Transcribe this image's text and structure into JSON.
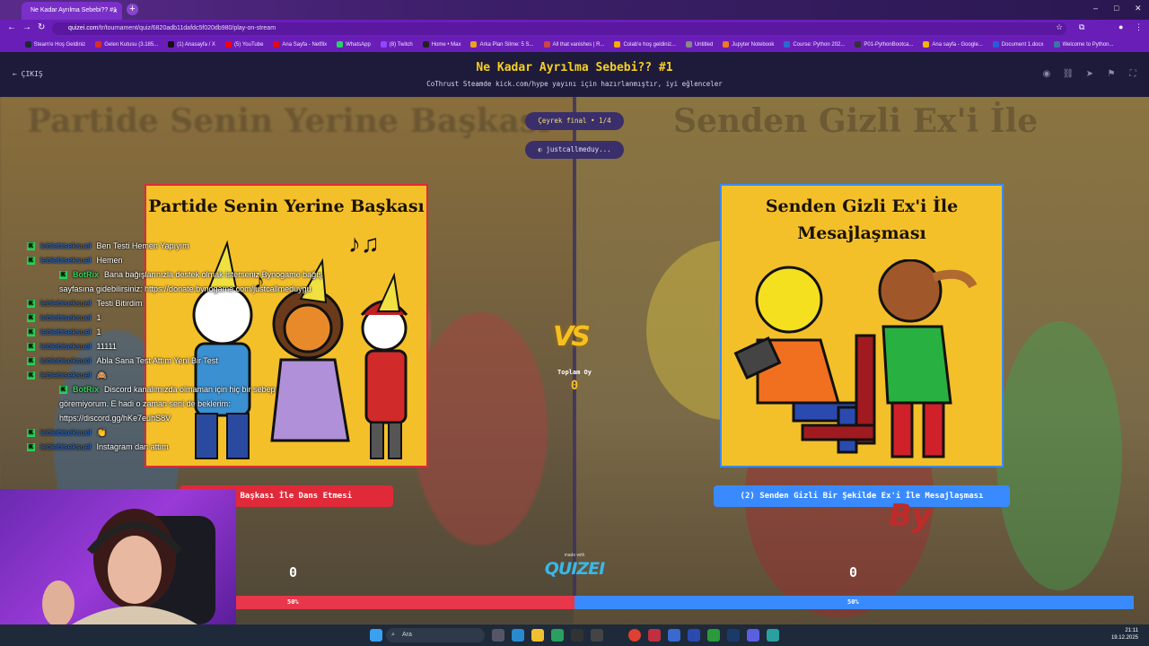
{
  "browser": {
    "tab_title": "Ne Kadar Ayrılma Sebebi?? #1",
    "url_domain": "quizei.com",
    "url_path": "/tr/tournament/quiz/6820adb11dafdc5f020db980/play-on-stream",
    "bookmarks": [
      "Steam'e Hoş Geldiniz",
      "Gelen Kutusu (3.185...",
      "(1) Anasayfa / X",
      "(5) YouTube",
      "Ana Sayfa - Netflix",
      "WhatsApp",
      "(8) Twitch",
      "Home • Max",
      "Arka Plan Silme: 5 S...",
      "All that vanishes | R...",
      "Colab'e hoş geldiniz...",
      "Untitled",
      "Jupyter Notebook",
      "Course: Python 202...",
      "P01-PythonBootca...",
      "Ana sayfa - Google...",
      "Document 1.docx",
      "Welcome to Python..."
    ]
  },
  "header": {
    "back_label": "ÇIKIŞ",
    "title": "Ne Kadar Ayrılma Sebebi?? #1",
    "subtitle": "CoThrust Steamde kick.com/hype yayını için hazırlanmıştır, iyi eğlenceler"
  },
  "round": {
    "stage": "Çeyrek final • 1/4",
    "user": "justcallmeduy..."
  },
  "left": {
    "card_title": "Partide Senin Yerine Başkası",
    "option_label": "ide Başkası İle Dans Etmesi",
    "score": "0",
    "percent": "50%",
    "bg_text": "Partide Senin Yerine Başkası"
  },
  "right": {
    "card_title": "Senden Gizli Ex'i İle Mesajlaşması",
    "option_label": "(2) Senden Gizli Bir Şekilde Ex'i İle Mesajlaşması",
    "score": "0",
    "percent": "50%",
    "bg_text": "Senden Gizli Ex'i İle"
  },
  "center": {
    "vs": "VS",
    "total_label": "Toplam Oy",
    "total_value": "0",
    "made_with": "made with",
    "logo": "QUIZEI"
  },
  "chat": [
    {
      "user": "leblebiseksuel",
      "text": "Ben Testi Hemen Yapıyım",
      "bot": false
    },
    {
      "user": "leblebiseksuel",
      "text": "Hemen",
      "bot": false
    },
    {
      "user": "BotRix",
      "text": "Bana bağışlarınızla destek olmak isterseniz Bynogame bağış sayfasına gidebilirsiniz: https://donate.bynogame.com/justcallmeduygu",
      "bot": true
    },
    {
      "user": "leblebiseksuel",
      "text": "Testi Bitirdim",
      "bot": false
    },
    {
      "user": "leblebiseksuel",
      "text": "1",
      "bot": false
    },
    {
      "user": "leblebiseksuel",
      "text": "1",
      "bot": false
    },
    {
      "user": "leblebiseksuel",
      "text": "11111",
      "bot": false
    },
    {
      "user": "leblebiseksuel",
      "text": "Abla Sana Test Attım Yeni Bir Test",
      "bot": false
    },
    {
      "user": "leblebiseksuel",
      "text": "🙈",
      "bot": false
    },
    {
      "user": "BotRix",
      "text": "Discord kanalımızda olmaman için hiç bir sebep göremiyorum. E hadi o zaman seni de beklerim: https://discord.gg/hKe7euhS8V",
      "bot": true
    },
    {
      "user": "leblebiseksuel",
      "text": "👏",
      "bot": false
    },
    {
      "user": "leblebiseksuel",
      "text": "Instagram dan attım",
      "bot": false
    }
  ],
  "taskbar": {
    "search_placeholder": "Ara",
    "time": "21:11",
    "date": "19.12.2025"
  },
  "colors": {
    "red": "#e02a3a",
    "blue": "#3a8aff",
    "gold": "#f5c020"
  }
}
